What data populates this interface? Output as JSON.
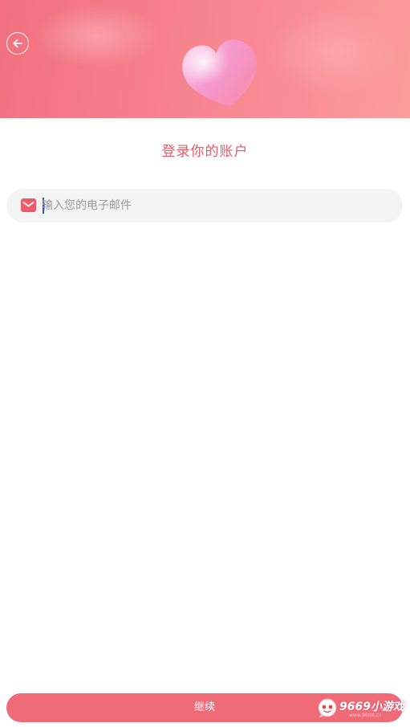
{
  "header": {
    "back_icon": "arrow-left-icon",
    "illustration": "heart-illustration"
  },
  "title": "登录你的账户",
  "email": {
    "icon": "mail-icon",
    "placeholder": "输入您的电子邮件",
    "value": ""
  },
  "continue_label": "继续",
  "watermark": {
    "brand": "9669小游戏",
    "url": "www.9669.cn"
  },
  "colors": {
    "accent": "#f06b78",
    "title": "#ea5a67",
    "header_start": "#f2707f",
    "header_end": "#fb9d98",
    "field_bg": "#f4f4f4"
  }
}
